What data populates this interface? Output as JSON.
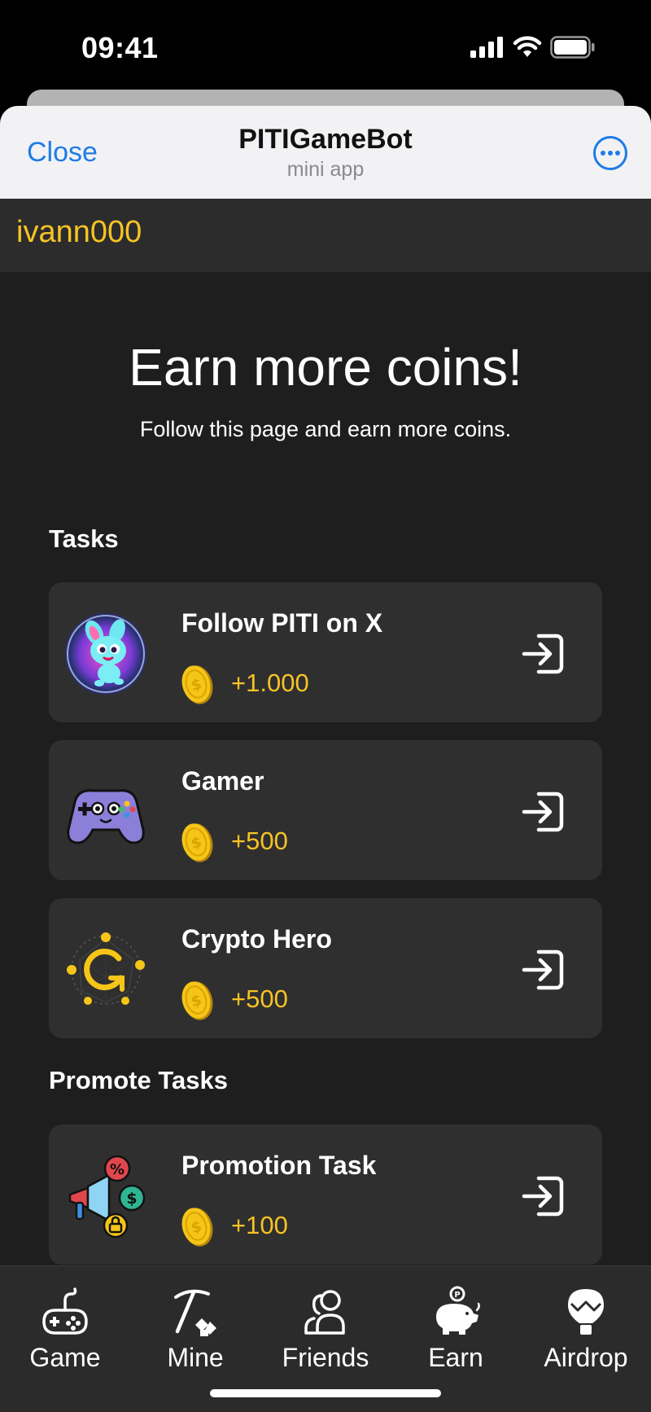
{
  "status_bar": {
    "time": "09:41"
  },
  "header": {
    "close_label": "Close",
    "title": "PITIGameBot",
    "subtitle": "mini app"
  },
  "user": {
    "username": "ivann000"
  },
  "main": {
    "headline": "Earn more coins!",
    "subheadline": "Follow this page and earn more coins."
  },
  "sections": {
    "tasks_title": "Tasks",
    "promote_title": "Promote Tasks"
  },
  "tasks": [
    {
      "title": "Follow PITI on X",
      "reward": "+1.000",
      "icon": "piti-mascot-icon"
    },
    {
      "title": "Gamer",
      "reward": "+500",
      "icon": "gamepad-icon"
    },
    {
      "title": "Crypto Hero",
      "reward": "+500",
      "icon": "crypto-hero-icon"
    }
  ],
  "promote_tasks": [
    {
      "title": "Promotion Task",
      "reward": "+100",
      "icon": "megaphone-icon"
    }
  ],
  "nav": {
    "items": [
      {
        "label": "Game",
        "icon": "joystick-icon"
      },
      {
        "label": "Mine",
        "icon": "pickaxe-icon"
      },
      {
        "label": "Friends",
        "icon": "friends-icon"
      },
      {
        "label": "Earn",
        "icon": "piggy-bank-icon"
      },
      {
        "label": "Airdrop",
        "icon": "balloon-icon"
      }
    ]
  },
  "colors": {
    "accent": "#f7c325",
    "link": "#1e7ce6",
    "background": "#1e1e1e",
    "card": "#2f2f2f"
  }
}
